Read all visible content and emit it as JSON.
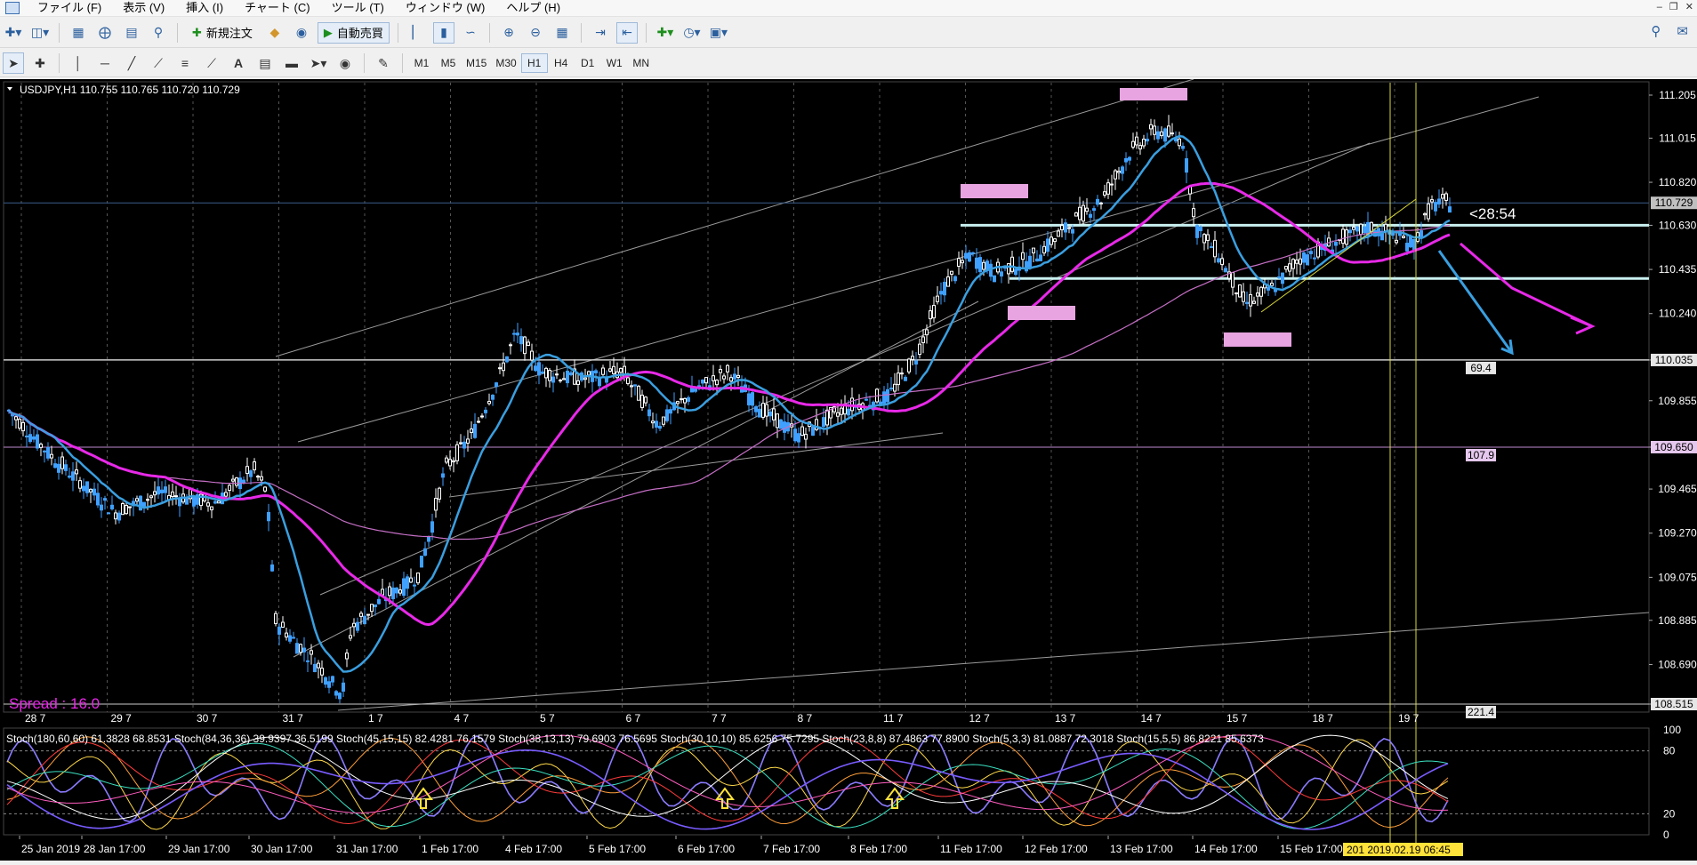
{
  "menu": [
    "ファイル (F)",
    "表示 (V)",
    "挿入 (I)",
    "チャート (C)",
    "ツール (T)",
    "ウィンドウ (W)",
    "ヘルプ (H)"
  ],
  "toolbar": {
    "new_order_label": "新規注文",
    "auto_trading_label": "自動売買"
  },
  "timeframes": [
    "M1",
    "M5",
    "M15",
    "M30",
    "H1",
    "H4",
    "D1",
    "W1",
    "MN"
  ],
  "active_timeframe": "H1",
  "chart": {
    "header": "USDJPY,H1  110.755 110.765 110.720 110.729",
    "spread_label": "Spread : 16.0",
    "timer_label": "<28:54",
    "price_axis": [
      "111.205",
      "111.015",
      "110.820",
      "110.630",
      "110.435",
      "110.240",
      "110.035",
      "109.855",
      "109.650",
      "109.465",
      "109.270",
      "109.075",
      "108.885",
      "108.690",
      "108.515"
    ],
    "current_price_label": "110.729",
    "level_tags": [
      "110.035",
      "109.650",
      "108.515"
    ],
    "level_distance_labels": [
      "69.4",
      "107.9",
      "221.4"
    ],
    "date_labels": [
      "28 7",
      "29 7",
      "30 7",
      "31 7",
      "1 7",
      "4 7",
      "5 7",
      "6 7",
      "7 7",
      "8 7",
      "11 7",
      "12 7",
      "13 7",
      "14 7",
      "15 7",
      "18 7",
      "19 7"
    ],
    "stoch_header": "Stoch(180,60,60) 61.3828 68.8531  Stoch(84,36,36) 39.9397 36.5199  Stoch(45,15,15) 82.4281 76.1579  Stoch(38,13,13) 79.6903 76.5695  Stoch(30,10,10) 85.6256 75.7295  Stoch(23,8,8) 87.4863 77.8900  Stoch(5,3,3) 81.0887 72.3018  Stoch(15,5,5) 86.8221 85.6373",
    "stoch_levels": [
      "100",
      "80",
      "20",
      "0"
    ],
    "time_labels": [
      "25 Jan 2019",
      "28 Jan 17:00",
      "29 Jan 17:00",
      "30 Jan 17:00",
      "31 Jan 17:00",
      "1 Feb 17:00",
      "4 Feb 17:00",
      "5 Feb 17:00",
      "6 Feb 17:00",
      "7 Feb 17:00",
      "8 Feb 17:00",
      "11 Feb 17:00",
      "12 Feb 17:00",
      "13 Feb 17:00",
      "14 Feb 17:00",
      "15 Feb 17:00"
    ],
    "crosshair_time_label": "2019.02.19 06:45",
    "crosshair_time_prefix": "201",
    "colors": {
      "background": "#000000",
      "bull": "#ffffff",
      "bear": "#3fa0ff",
      "ma_fast": "#3a9fe0",
      "ma_mid": "#e829e8",
      "ma_slow": "#c56fc5",
      "zone": "#e7a4e0",
      "level_line": "#c9f0f0",
      "crosshair": "#d9d93a"
    }
  }
}
